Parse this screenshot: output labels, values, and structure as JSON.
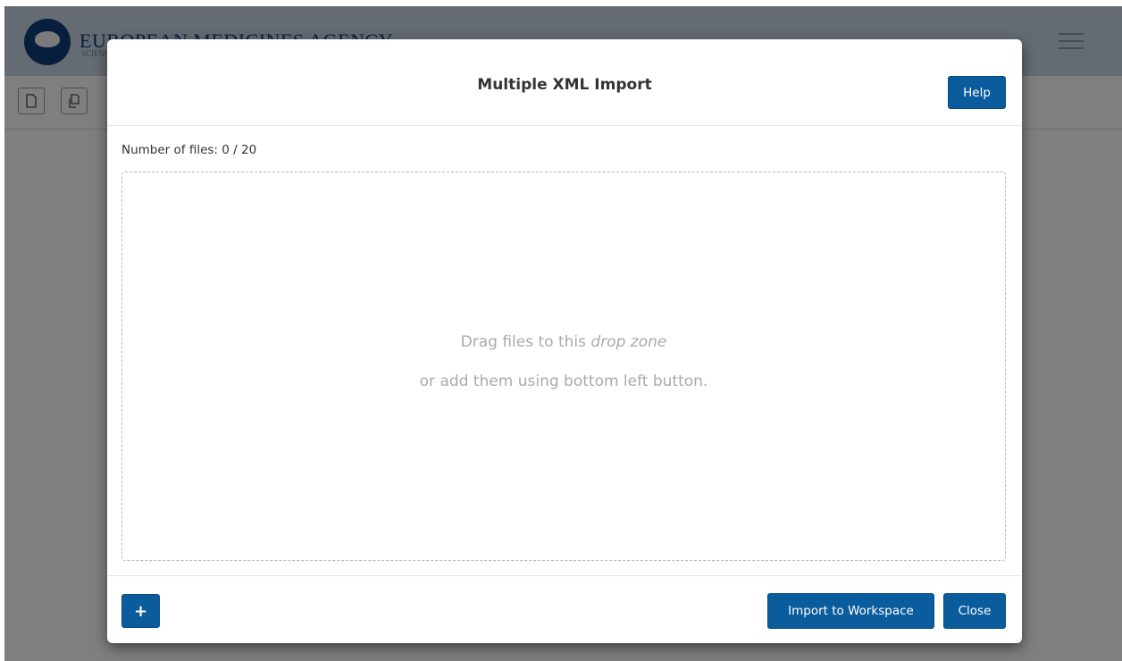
{
  "app": {
    "logo_title": "EUROPEAN MEDICINES AGENCY",
    "logo_subtitle": "SCIENCE MEDICINES HEALTH",
    "toolbar": {
      "new_icon": "document-icon",
      "copy_icon": "copy-document-icon"
    },
    "menu_icon": "hamburger-icon"
  },
  "modal": {
    "title": "Multiple XML Import",
    "help_label": "Help",
    "file_count_label": "Number of files: 0 / 20",
    "drop_zone": {
      "line1_prefix": "Drag files to this ",
      "line1_emphasis": "drop zone",
      "line2": "or add them using bottom left button."
    },
    "add_label": "+",
    "add_icon": "plus-icon",
    "import_label": "Import to Workspace",
    "close_label": "Close"
  },
  "colors": {
    "primary": "#0a5c9c",
    "overlay": "rgba(0,0,0,0.5)",
    "header_bg": "#c9d7e4",
    "brand": "#0e3c7a"
  }
}
